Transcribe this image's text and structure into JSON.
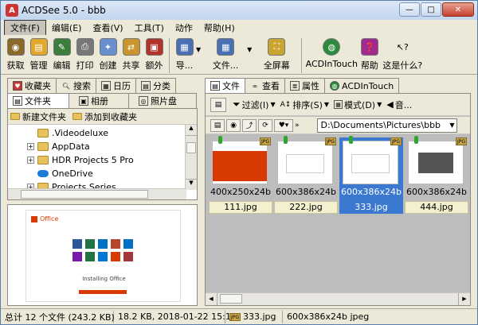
{
  "window": {
    "title": "ACDSee 5.0 - bbb",
    "minimize": "—",
    "maximize": "□",
    "close": "✕"
  },
  "menu": [
    "文件(F)",
    "编辑(E)",
    "查看(V)",
    "工具(T)",
    "动作",
    "帮助(H)"
  ],
  "toolbar": {
    "acquire": "获取",
    "manage": "管理",
    "edit": "编辑",
    "print": "打印",
    "create": "创建",
    "share": "共享",
    "extra": "额外",
    "guide": "导...",
    "file": "文件...",
    "fullscreen": "全屏幕",
    "acdintouch": "ACDInTouch",
    "help": "帮助",
    "whatsthis": "这是什么?"
  },
  "left_tabs_top": {
    "favorites": "收藏夹",
    "search": "搜索",
    "calendar": "日历",
    "category": "分类"
  },
  "left_tabs_bottom": {
    "folders": "文件夹",
    "album": "相册",
    "photo_disc": "照片盘"
  },
  "left_actions": {
    "new_folder": "新建文件夹",
    "add_favorite": "添加到收藏夹"
  },
  "tree": [
    {
      "label": ".Videodeluxe",
      "expandable": false
    },
    {
      "label": "AppData",
      "expandable": true
    },
    {
      "label": "HDR Projects 5 Pro",
      "expandable": true
    },
    {
      "label": "OneDrive",
      "expandable": false,
      "icon": "cloud-icon"
    },
    {
      "label": "Projects Series",
      "expandable": true
    }
  ],
  "right_tabs": {
    "file": "文件",
    "view": "查看",
    "properties": "属性",
    "acdintouch": "ACDInTouch"
  },
  "right_toolbar": {
    "filter": "过滤(I)",
    "sort": "排序(S)",
    "mode": "模式(D)",
    "sound": "音..."
  },
  "path": "D:\\Documents\\Pictures\\bbb",
  "thumbnails": [
    {
      "info": "400x250x24b",
      "name": "111.jpg",
      "selected": false
    },
    {
      "info": "600x386x24b",
      "name": "222.jpg",
      "selected": false
    },
    {
      "info": "600x386x24b",
      "name": "333.jpg",
      "selected": true
    },
    {
      "info": "600x386x24b",
      "name": "444.jpg",
      "selected": false
    }
  ],
  "preview": {
    "brand": "Office",
    "caption": "Installing Office"
  },
  "badge": "JPG",
  "status": {
    "total": "总计 12 个文件 (243.2 KB)",
    "size_date": "18.2 KB, 2018-01-22 15:13",
    "filename": "333.jpg",
    "details": "600x386x24b jpeg"
  }
}
